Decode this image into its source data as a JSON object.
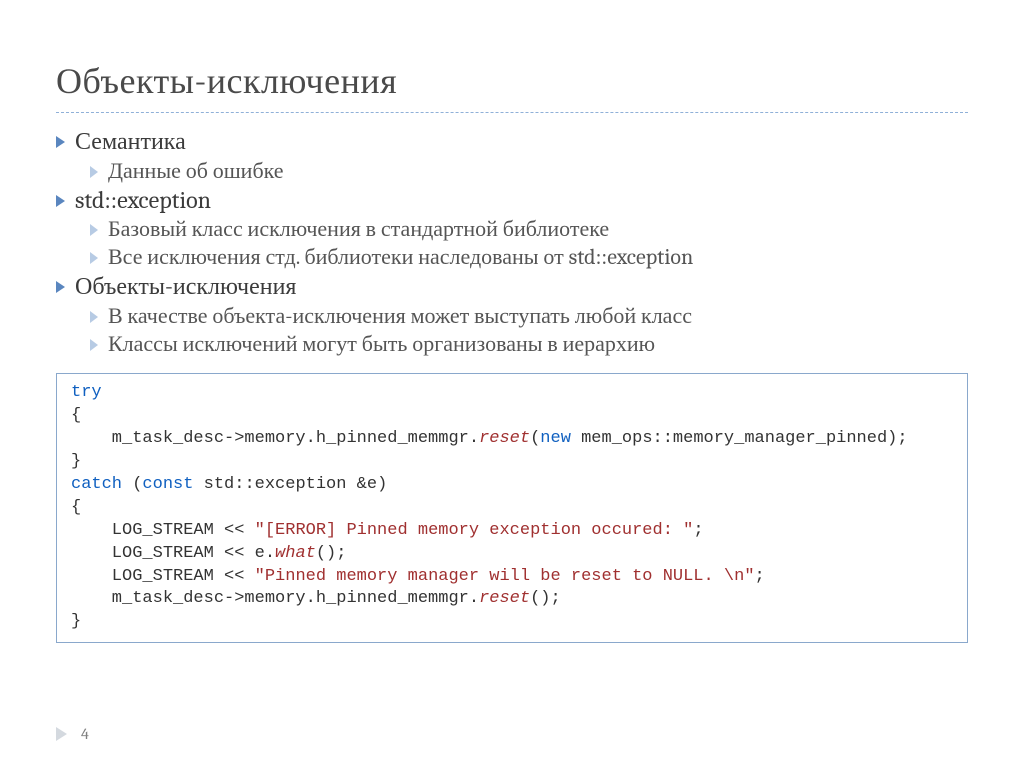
{
  "title": "Объекты-исключения",
  "bullets": [
    {
      "level": 1,
      "text": "Семантика"
    },
    {
      "level": 2,
      "text": "Данные об ошибке"
    },
    {
      "level": 1,
      "text": "std::exception"
    },
    {
      "level": 2,
      "text": "Базовый класс исключения в стандартной библиотеке"
    },
    {
      "level": 2,
      "text": "Все исключения стд. библиотеки наследованы от std::exception"
    },
    {
      "level": 1,
      "text": "Объекты-исключения"
    },
    {
      "level": 2,
      "text": "В качестве объекта-исключения может выступать любой класс"
    },
    {
      "level": 2,
      "text": "Классы исключений могут быть организованы в иерархию"
    }
  ],
  "code": {
    "kw_try": "try",
    "brace_open1": "{",
    "line1_a": "    m_task_desc->memory.h_pinned_memmgr.",
    "line1_fn": "reset",
    "line1_b": "(",
    "line1_kw_new": "new",
    "line1_c": " mem_ops::memory_manager_pinned);",
    "brace_close1": "}",
    "kw_catch": "catch",
    "catch_a": " (",
    "kw_const": "const",
    "catch_b": " std::exception &e)",
    "brace_open2": "{",
    "log1_a": "    LOG_STREAM << ",
    "log1_str": "\"[ERROR] Pinned memory exception occured: \"",
    "log1_b": ";",
    "log2_a": "    LOG_STREAM << e.",
    "log2_fn": "what",
    "log2_b": "();",
    "log3_a": "    LOG_STREAM << ",
    "log3_str": "\"Pinned memory manager will be reset to NULL. \\n\"",
    "log3_b": ";",
    "line4_a": "    m_task_desc->memory.h_pinned_memmgr.",
    "line4_fn": "reset",
    "line4_b": "();",
    "brace_close2": "}"
  },
  "page_number": "4"
}
